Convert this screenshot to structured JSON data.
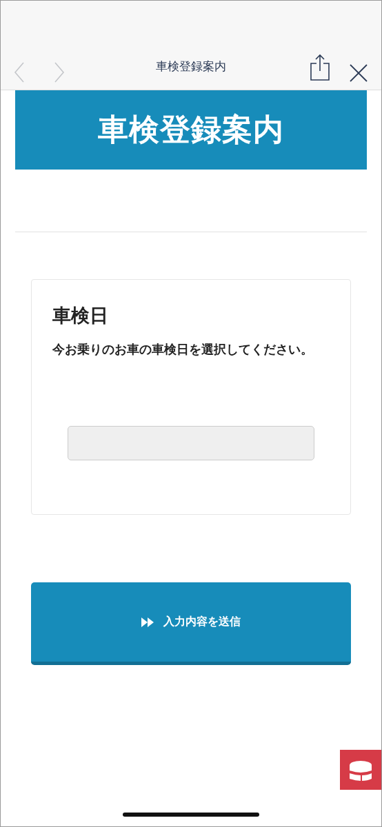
{
  "browser_bar": {
    "title": "車検登録案内",
    "back_disabled": true,
    "forward_disabled": true
  },
  "banner": {
    "title": "車検登録案内"
  },
  "card": {
    "title": "車検日",
    "description": "今お乗りのお車の車検日を選択してください。"
  },
  "submit_button": {
    "label": "入力内容を送信"
  }
}
